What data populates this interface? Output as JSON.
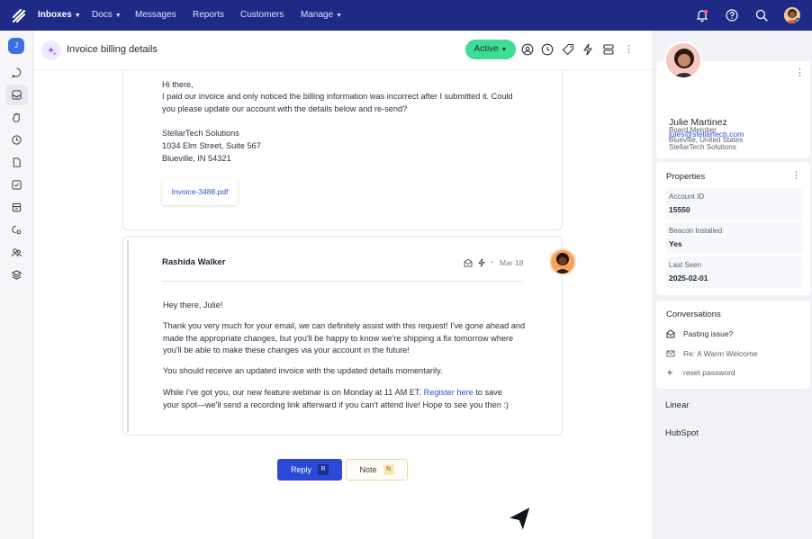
{
  "nav": {
    "items": [
      {
        "label": "Inboxes",
        "active": true,
        "dropdown": true
      },
      {
        "label": "Docs",
        "active": false,
        "dropdown": true
      },
      {
        "label": "Messages",
        "active": false,
        "dropdown": false
      },
      {
        "label": "Reports",
        "active": false,
        "dropdown": false
      },
      {
        "label": "Customers",
        "active": false,
        "dropdown": false
      },
      {
        "label": "Manage",
        "active": false,
        "dropdown": true
      }
    ],
    "icons": [
      "bell-icon",
      "help-icon",
      "search-icon",
      "user-avatar"
    ]
  },
  "rail": {
    "avatar_initial": "J",
    "icons": [
      "chat-icon",
      "inbox-icon",
      "hand-icon",
      "clock-icon",
      "document-icon",
      "inbox-check-icon",
      "archive-icon",
      "settings-bubble-icon",
      "users-icon",
      "layers-icon"
    ]
  },
  "conversation": {
    "title": "Invoice billing details",
    "status": "Active",
    "header_icons": [
      "assign-user-icon",
      "snooze-clock-icon",
      "tag-icon",
      "workflow-bolt-icon",
      "layout-icon",
      "more-icon"
    ]
  },
  "customer_message": {
    "greeting": "Hi there,",
    "body": "I paid our invoice and only noticed the billing information was  incorrect after I submitted it. Could you please update our account with the details below and re-send?",
    "address_lines": [
      "StellarTech Solutions",
      "1034 Elm Street, Suite 567",
      "Blueville, IN 54321"
    ],
    "attachment": "Invoice-3488.pdf"
  },
  "agent_message": {
    "author": "Rashida Walker",
    "date": "Mar 18",
    "greeting": "Hey there, Julie!",
    "paragraph1": "Thank you very much for your email, we can definitely assist with this request! I've gone ahead and made the appropriate changes, but you'll be happy to know we're shipping a fix tomorrow where you'll be able to make these changes via your account in the future!",
    "paragraph2": "You should receive an updated invoice with the updated details momentarily.",
    "paragraph3_before": "While I've got you, our new feature webinar is on Monday at 11 AM ET. ",
    "paragraph3_link": "Register here",
    "paragraph3_after": " to save your spot—we'll send a recording link afterward if you can't attend live! Hope to see you then :)"
  },
  "composer": {
    "reply_label": "Reply",
    "reply_shortcut": "R",
    "note_label": "Note",
    "note_shortcut": "N"
  },
  "profile": {
    "name": "Julie Martinez",
    "email": "jules@stellartech.com",
    "company": "StellarTech Solutions",
    "role": "Board Member",
    "location": "Blueville, United States"
  },
  "properties": {
    "title": "Properties",
    "items": [
      {
        "label": "Account ID",
        "value": "15550"
      },
      {
        "label": "Beacon Installed",
        "value": "Yes"
      },
      {
        "label": "Last Seen",
        "value": "2025-02-01"
      }
    ]
  },
  "conversations": {
    "title": "Conversations",
    "items": [
      {
        "label": "Pasting issue?",
        "icon": "mail-open-icon"
      },
      {
        "label": "Re: A Warm Welcome",
        "icon": "mail-icon"
      },
      {
        "label": "reset password",
        "icon": "sparkle-icon"
      }
    ]
  },
  "integrations": [
    "Linear",
    "HubSpot"
  ],
  "colors": {
    "nav_bg": "#1f2a86",
    "accent": "#2b48d7",
    "status_active": "#3fdc95",
    "link": "#2c4fd1",
    "note_border": "#f0d59e"
  }
}
